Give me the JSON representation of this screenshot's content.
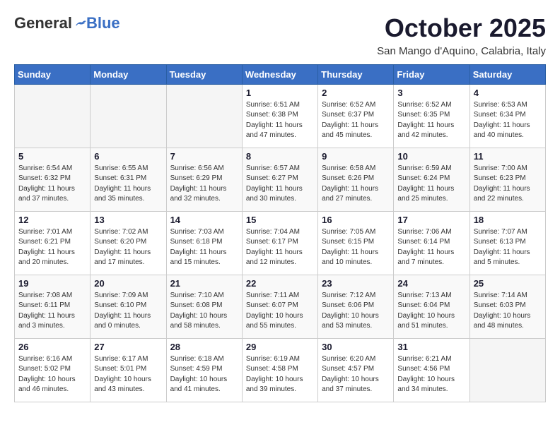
{
  "header": {
    "logo_general": "General",
    "logo_blue": "Blue",
    "month_title": "October 2025",
    "location": "San Mango d'Aquino, Calabria, Italy"
  },
  "weekdays": [
    "Sunday",
    "Monday",
    "Tuesday",
    "Wednesday",
    "Thursday",
    "Friday",
    "Saturday"
  ],
  "weeks": [
    [
      {
        "day": "",
        "info": ""
      },
      {
        "day": "",
        "info": ""
      },
      {
        "day": "",
        "info": ""
      },
      {
        "day": "1",
        "info": "Sunrise: 6:51 AM\nSunset: 6:38 PM\nDaylight: 11 hours\nand 47 minutes."
      },
      {
        "day": "2",
        "info": "Sunrise: 6:52 AM\nSunset: 6:37 PM\nDaylight: 11 hours\nand 45 minutes."
      },
      {
        "day": "3",
        "info": "Sunrise: 6:52 AM\nSunset: 6:35 PM\nDaylight: 11 hours\nand 42 minutes."
      },
      {
        "day": "4",
        "info": "Sunrise: 6:53 AM\nSunset: 6:34 PM\nDaylight: 11 hours\nand 40 minutes."
      }
    ],
    [
      {
        "day": "5",
        "info": "Sunrise: 6:54 AM\nSunset: 6:32 PM\nDaylight: 11 hours\nand 37 minutes."
      },
      {
        "day": "6",
        "info": "Sunrise: 6:55 AM\nSunset: 6:31 PM\nDaylight: 11 hours\nand 35 minutes."
      },
      {
        "day": "7",
        "info": "Sunrise: 6:56 AM\nSunset: 6:29 PM\nDaylight: 11 hours\nand 32 minutes."
      },
      {
        "day": "8",
        "info": "Sunrise: 6:57 AM\nSunset: 6:27 PM\nDaylight: 11 hours\nand 30 minutes."
      },
      {
        "day": "9",
        "info": "Sunrise: 6:58 AM\nSunset: 6:26 PM\nDaylight: 11 hours\nand 27 minutes."
      },
      {
        "day": "10",
        "info": "Sunrise: 6:59 AM\nSunset: 6:24 PM\nDaylight: 11 hours\nand 25 minutes."
      },
      {
        "day": "11",
        "info": "Sunrise: 7:00 AM\nSunset: 6:23 PM\nDaylight: 11 hours\nand 22 minutes."
      }
    ],
    [
      {
        "day": "12",
        "info": "Sunrise: 7:01 AM\nSunset: 6:21 PM\nDaylight: 11 hours\nand 20 minutes."
      },
      {
        "day": "13",
        "info": "Sunrise: 7:02 AM\nSunset: 6:20 PM\nDaylight: 11 hours\nand 17 minutes."
      },
      {
        "day": "14",
        "info": "Sunrise: 7:03 AM\nSunset: 6:18 PM\nDaylight: 11 hours\nand 15 minutes."
      },
      {
        "day": "15",
        "info": "Sunrise: 7:04 AM\nSunset: 6:17 PM\nDaylight: 11 hours\nand 12 minutes."
      },
      {
        "day": "16",
        "info": "Sunrise: 7:05 AM\nSunset: 6:15 PM\nDaylight: 11 hours\nand 10 minutes."
      },
      {
        "day": "17",
        "info": "Sunrise: 7:06 AM\nSunset: 6:14 PM\nDaylight: 11 hours\nand 7 minutes."
      },
      {
        "day": "18",
        "info": "Sunrise: 7:07 AM\nSunset: 6:13 PM\nDaylight: 11 hours\nand 5 minutes."
      }
    ],
    [
      {
        "day": "19",
        "info": "Sunrise: 7:08 AM\nSunset: 6:11 PM\nDaylight: 11 hours\nand 3 minutes."
      },
      {
        "day": "20",
        "info": "Sunrise: 7:09 AM\nSunset: 6:10 PM\nDaylight: 11 hours\nand 0 minutes."
      },
      {
        "day": "21",
        "info": "Sunrise: 7:10 AM\nSunset: 6:08 PM\nDaylight: 10 hours\nand 58 minutes."
      },
      {
        "day": "22",
        "info": "Sunrise: 7:11 AM\nSunset: 6:07 PM\nDaylight: 10 hours\nand 55 minutes."
      },
      {
        "day": "23",
        "info": "Sunrise: 7:12 AM\nSunset: 6:06 PM\nDaylight: 10 hours\nand 53 minutes."
      },
      {
        "day": "24",
        "info": "Sunrise: 7:13 AM\nSunset: 6:04 PM\nDaylight: 10 hours\nand 51 minutes."
      },
      {
        "day": "25",
        "info": "Sunrise: 7:14 AM\nSunset: 6:03 PM\nDaylight: 10 hours\nand 48 minutes."
      }
    ],
    [
      {
        "day": "26",
        "info": "Sunrise: 6:16 AM\nSunset: 5:02 PM\nDaylight: 10 hours\nand 46 minutes."
      },
      {
        "day": "27",
        "info": "Sunrise: 6:17 AM\nSunset: 5:01 PM\nDaylight: 10 hours\nand 43 minutes."
      },
      {
        "day": "28",
        "info": "Sunrise: 6:18 AM\nSunset: 4:59 PM\nDaylight: 10 hours\nand 41 minutes."
      },
      {
        "day": "29",
        "info": "Sunrise: 6:19 AM\nSunset: 4:58 PM\nDaylight: 10 hours\nand 39 minutes."
      },
      {
        "day": "30",
        "info": "Sunrise: 6:20 AM\nSunset: 4:57 PM\nDaylight: 10 hours\nand 37 minutes."
      },
      {
        "day": "31",
        "info": "Sunrise: 6:21 AM\nSunset: 4:56 PM\nDaylight: 10 hours\nand 34 minutes."
      },
      {
        "day": "",
        "info": ""
      }
    ]
  ]
}
